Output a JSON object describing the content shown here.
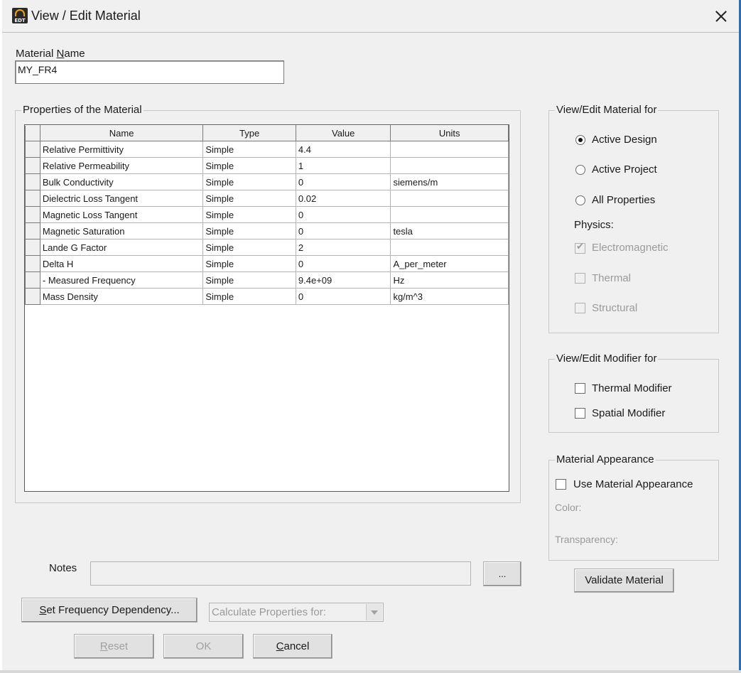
{
  "window": {
    "title": "View / Edit Material",
    "icon_text": "EDT"
  },
  "material_name": {
    "label_prefix": "Material ",
    "label_mnemonic": "N",
    "label_suffix": "ame",
    "value": "MY_FR4"
  },
  "properties": {
    "group_title": "Properties of the Material",
    "columns": [
      "Name",
      "Type",
      "Value",
      "Units"
    ],
    "rows": [
      [
        "Relative Permittivity",
        "Simple",
        "4.4",
        ""
      ],
      [
        "Relative Permeability",
        "Simple",
        "1",
        ""
      ],
      [
        "Bulk Conductivity",
        "Simple",
        "0",
        "siemens/m"
      ],
      [
        "Dielectric Loss Tangent",
        "Simple",
        "0.02",
        ""
      ],
      [
        "Magnetic Loss Tangent",
        "Simple",
        "0",
        ""
      ],
      [
        "Magnetic Saturation",
        "Simple",
        "0",
        "tesla"
      ],
      [
        "Lande G Factor",
        "Simple",
        "2",
        ""
      ],
      [
        "Delta H",
        "Simple",
        "0",
        "A_per_meter"
      ],
      [
        "- Measured Frequency",
        "Simple",
        "9.4e+09",
        "Hz"
      ],
      [
        "Mass Density",
        "Simple",
        "0",
        "kg/m^3"
      ]
    ]
  },
  "view_edit_for": {
    "group_title": "View/Edit Material for",
    "options": [
      "Active Design",
      "Active Project",
      "All Properties"
    ],
    "selected": "Active Design",
    "physics_label": "Physics:",
    "physics": [
      {
        "label": "Electromagnetic",
        "checked": true
      },
      {
        "label": "Thermal",
        "checked": false
      },
      {
        "label": "Structural",
        "checked": false
      }
    ]
  },
  "modifier": {
    "group_title": "View/Edit Modifier for",
    "thermal": "Thermal Modifier",
    "spatial": "Spatial Modifier"
  },
  "appearance": {
    "group_title": "Material Appearance",
    "use_label": "Use Material Appearance",
    "color_label": "Color:",
    "transparency_label": "Transparency:"
  },
  "notes": {
    "label": "Notes",
    "value": "",
    "browse_label": "..."
  },
  "buttons": {
    "validate": "Validate Material",
    "set_freq_mnemonic": "S",
    "set_freq_rest": "et Frequency Dependency...",
    "calc_placeholder": "Calculate Properties for:",
    "reset_mnemonic": "R",
    "reset_rest": "eset",
    "ok": "OK",
    "cancel_mnemonic": "C",
    "cancel_rest": "ancel"
  },
  "colors": {
    "window_bg": "#f0f0f0",
    "disabled_text": "#9a9a9a"
  }
}
